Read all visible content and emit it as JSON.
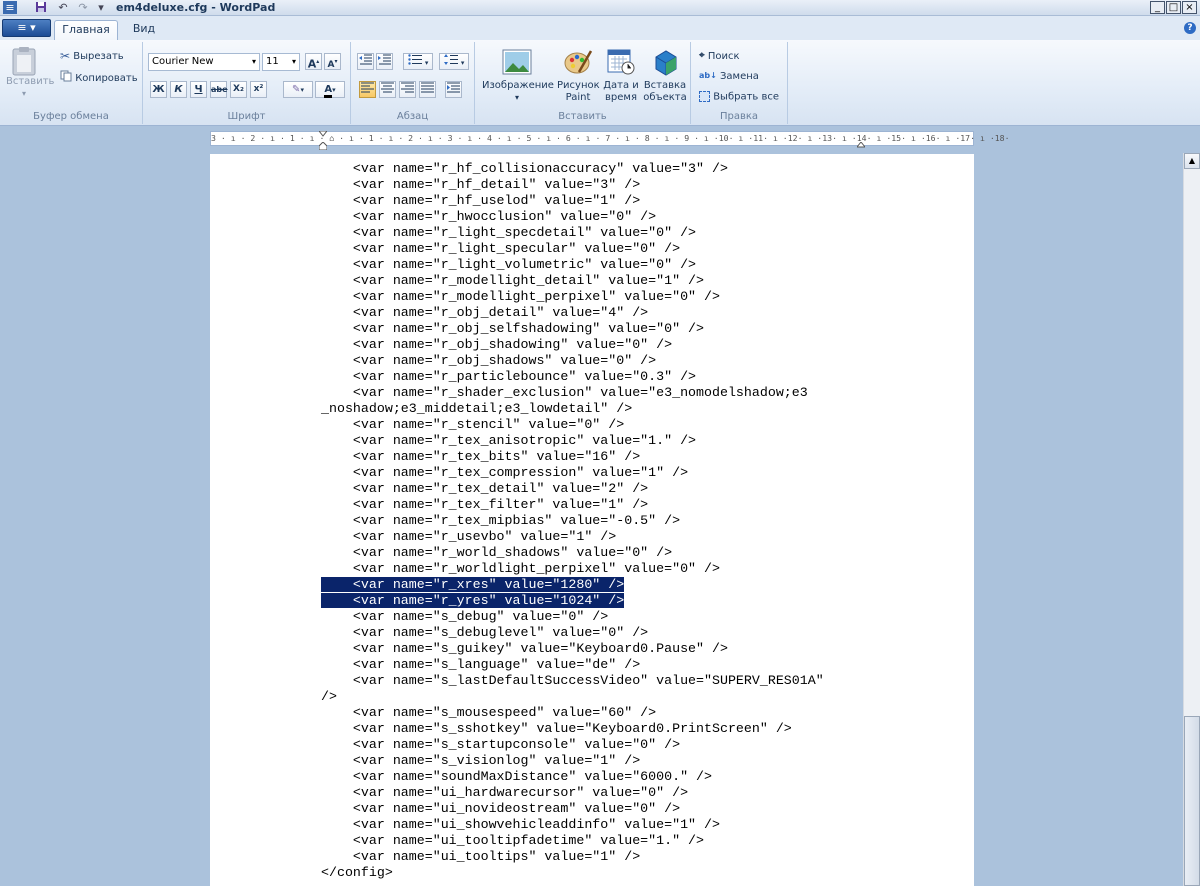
{
  "window": {
    "title": "em4deluxe.cfg - WordPad",
    "controls": {
      "minimize": "_",
      "maximize": "□",
      "close": "×"
    }
  },
  "quick_access": {
    "save_icon": "save-icon",
    "undo_icon": "undo-icon",
    "redo_icon": "redo-icon",
    "customize_icon": "dropdown-icon"
  },
  "tabs": {
    "menu_label": "≡ ▾",
    "home": "Главная",
    "view": "Вид",
    "help": "?"
  },
  "ribbon": {
    "clipboard": {
      "label": "Буфер обмена",
      "paste": "Вставить",
      "cut": "Вырезать",
      "copy": "Копировать"
    },
    "font": {
      "label": "Шрифт",
      "family": "Courier New",
      "size": "11",
      "grow": "A",
      "shrink": "A",
      "bold": "Ж",
      "italic": "К",
      "underline": "Ч",
      "strike": "abe",
      "subscript": "X₂",
      "superscript": "x²",
      "color_letter": "A"
    },
    "paragraph": {
      "label": "Абзац"
    },
    "insert": {
      "label": "Вставить",
      "image": "Изображение",
      "paint_line1": "Рисунок",
      "paint_line2": "Paint",
      "datetime_line1": "Дата и",
      "datetime_line2": "время",
      "object_line1": "Вставка",
      "object_line2": "объекта"
    },
    "editing": {
      "label": "Правка",
      "find": "Поиск",
      "replace": "Замена",
      "select_all": "Выбрать все"
    }
  },
  "ruler": {
    "text": "3 · ı · 2 · ı · 1 · ı · ⌂ · ı · 1 · ı · 2 · ı · 3 · ı · 4 · ı · 5 · ı · 6 · ı · 7 · ı · 8 · ı · 9 · ı ·10· ı ·11· ı ·12· ı ·13· ı ·14· ı ·15· ı ·16· ı ·17· ı ·18·"
  },
  "document": {
    "lines": [
      {
        "text": "    <var name=\"r_hf_collisionaccuracy\" value=\"3\" />",
        "selected": false
      },
      {
        "text": "    <var name=\"r_hf_detail\" value=\"3\" />",
        "selected": false
      },
      {
        "text": "    <var name=\"r_hf_uselod\" value=\"1\" />",
        "selected": false
      },
      {
        "text": "    <var name=\"r_hwocclusion\" value=\"0\" />",
        "selected": false
      },
      {
        "text": "    <var name=\"r_light_specdetail\" value=\"0\" />",
        "selected": false
      },
      {
        "text": "    <var name=\"r_light_specular\" value=\"0\" />",
        "selected": false
      },
      {
        "text": "    <var name=\"r_light_volumetric\" value=\"0\" />",
        "selected": false
      },
      {
        "text": "    <var name=\"r_modellight_detail\" value=\"1\" />",
        "selected": false
      },
      {
        "text": "    <var name=\"r_modellight_perpixel\" value=\"0\" />",
        "selected": false
      },
      {
        "text": "    <var name=\"r_obj_detail\" value=\"4\" />",
        "selected": false
      },
      {
        "text": "    <var name=\"r_obj_selfshadowing\" value=\"0\" />",
        "selected": false
      },
      {
        "text": "    <var name=\"r_obj_shadowing\" value=\"0\" />",
        "selected": false
      },
      {
        "text": "    <var name=\"r_obj_shadows\" value=\"0\" />",
        "selected": false
      },
      {
        "text": "    <var name=\"r_particlebounce\" value=\"0.3\" />",
        "selected": false
      },
      {
        "text": "    <var name=\"r_shader_exclusion\" value=\"e3_nomodelshadow;e3",
        "selected": false
      },
      {
        "text": "_noshadow;e3_middetail;e3_lowdetail\" />",
        "selected": false
      },
      {
        "text": "    <var name=\"r_stencil\" value=\"0\" />",
        "selected": false
      },
      {
        "text": "    <var name=\"r_tex_anisotropic\" value=\"1.\" />",
        "selected": false
      },
      {
        "text": "    <var name=\"r_tex_bits\" value=\"16\" />",
        "selected": false
      },
      {
        "text": "    <var name=\"r_tex_compression\" value=\"1\" />",
        "selected": false
      },
      {
        "text": "    <var name=\"r_tex_detail\" value=\"2\" />",
        "selected": false
      },
      {
        "text": "    <var name=\"r_tex_filter\" value=\"1\" />",
        "selected": false
      },
      {
        "text": "    <var name=\"r_tex_mipbias\" value=\"-0.5\" />",
        "selected": false
      },
      {
        "text": "    <var name=\"r_usevbo\" value=\"1\" />",
        "selected": false
      },
      {
        "text": "    <var name=\"r_world_shadows\" value=\"0\" />",
        "selected": false
      },
      {
        "text": "    <var name=\"r_worldlight_perpixel\" value=\"0\" />",
        "selected": false
      },
      {
        "text": "    <var name=\"r_xres\" value=\"1280\" />",
        "selected": true
      },
      {
        "text": "    <var name=\"r_yres\" value=\"1024\" />",
        "selected": true
      },
      {
        "text": "    <var name=\"s_debug\" value=\"0\" />",
        "selected": false
      },
      {
        "text": "    <var name=\"s_debuglevel\" value=\"0\" />",
        "selected": false
      },
      {
        "text": "    <var name=\"s_guikey\" value=\"Keyboard0.Pause\" />",
        "selected": false
      },
      {
        "text": "    <var name=\"s_language\" value=\"de\" />",
        "selected": false
      },
      {
        "text": "    <var name=\"s_lastDefaultSuccessVideo\" value=\"SUPERV_RES01A\"",
        "selected": false
      },
      {
        "text": "/>",
        "selected": false
      },
      {
        "text": "    <var name=\"s_mousespeed\" value=\"60\" />",
        "selected": false
      },
      {
        "text": "    <var name=\"s_sshotkey\" value=\"Keyboard0.PrintScreen\" />",
        "selected": false
      },
      {
        "text": "    <var name=\"s_startupconsole\" value=\"0\" />",
        "selected": false
      },
      {
        "text": "    <var name=\"s_visionlog\" value=\"1\" />",
        "selected": false
      },
      {
        "text": "    <var name=\"soundMaxDistance\" value=\"6000.\" />",
        "selected": false
      },
      {
        "text": "    <var name=\"ui_hardwarecursor\" value=\"0\" />",
        "selected": false
      },
      {
        "text": "    <var name=\"ui_novideostream\" value=\"0\" />",
        "selected": false
      },
      {
        "text": "    <var name=\"ui_showvehicleaddinfo\" value=\"1\" />",
        "selected": false
      },
      {
        "text": "    <var name=\"ui_tooltipfadetime\" value=\"1.\" />",
        "selected": false
      },
      {
        "text": "    <var name=\"ui_tooltips\" value=\"1\" />",
        "selected": false
      },
      {
        "text": "</config>",
        "selected": false
      }
    ]
  },
  "colors": {
    "selection": "#0a246a",
    "workspace": "#abc2dc",
    "ribbon": "#dfe9f5"
  }
}
